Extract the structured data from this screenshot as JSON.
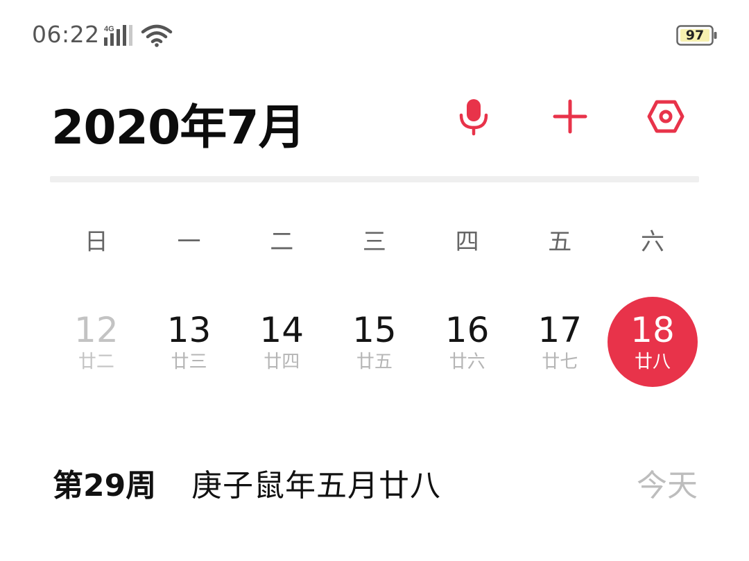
{
  "status_bar": {
    "time": "06:22",
    "network": "4G",
    "battery": "97"
  },
  "header": {
    "title": "2020年7月",
    "accent_color": "#e8334a",
    "actions": [
      {
        "name": "mic",
        "icon": "microphone-icon"
      },
      {
        "name": "add",
        "icon": "plus-icon"
      },
      {
        "name": "settings",
        "icon": "hexagon-settings-icon"
      }
    ]
  },
  "week": {
    "weekdays": [
      "日",
      "一",
      "二",
      "三",
      "四",
      "五",
      "六"
    ],
    "days": [
      {
        "day": "12",
        "lunar": "廿二",
        "state": "past"
      },
      {
        "day": "13",
        "lunar": "廿三",
        "state": "normal"
      },
      {
        "day": "14",
        "lunar": "廿四",
        "state": "normal"
      },
      {
        "day": "15",
        "lunar": "廿五",
        "state": "normal"
      },
      {
        "day": "16",
        "lunar": "廿六",
        "state": "normal"
      },
      {
        "day": "17",
        "lunar": "廿七",
        "state": "normal"
      },
      {
        "day": "18",
        "lunar": "廿八",
        "state": "selected"
      }
    ]
  },
  "info": {
    "week_number": "第29周",
    "lunar_date": "庚子鼠年五月廿八",
    "today_label": "今天"
  }
}
